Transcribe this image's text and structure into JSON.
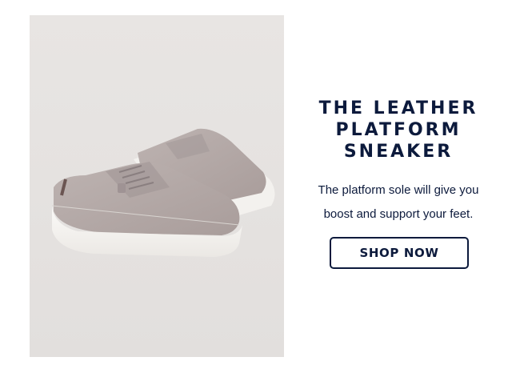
{
  "hero": {
    "headline_lines": [
      "THE LEATHER",
      "PLATFORM",
      "SNEAKER"
    ],
    "body_lines": [
      "The platform sole will give you",
      "boost and support your feet."
    ],
    "cta_label": "SHOP NOW"
  },
  "colors": {
    "navy": "#0c1a3c",
    "image_background": "#e6e3e1",
    "shoe_upper": "#b5aaa8",
    "sole": "#f8f6f3"
  }
}
